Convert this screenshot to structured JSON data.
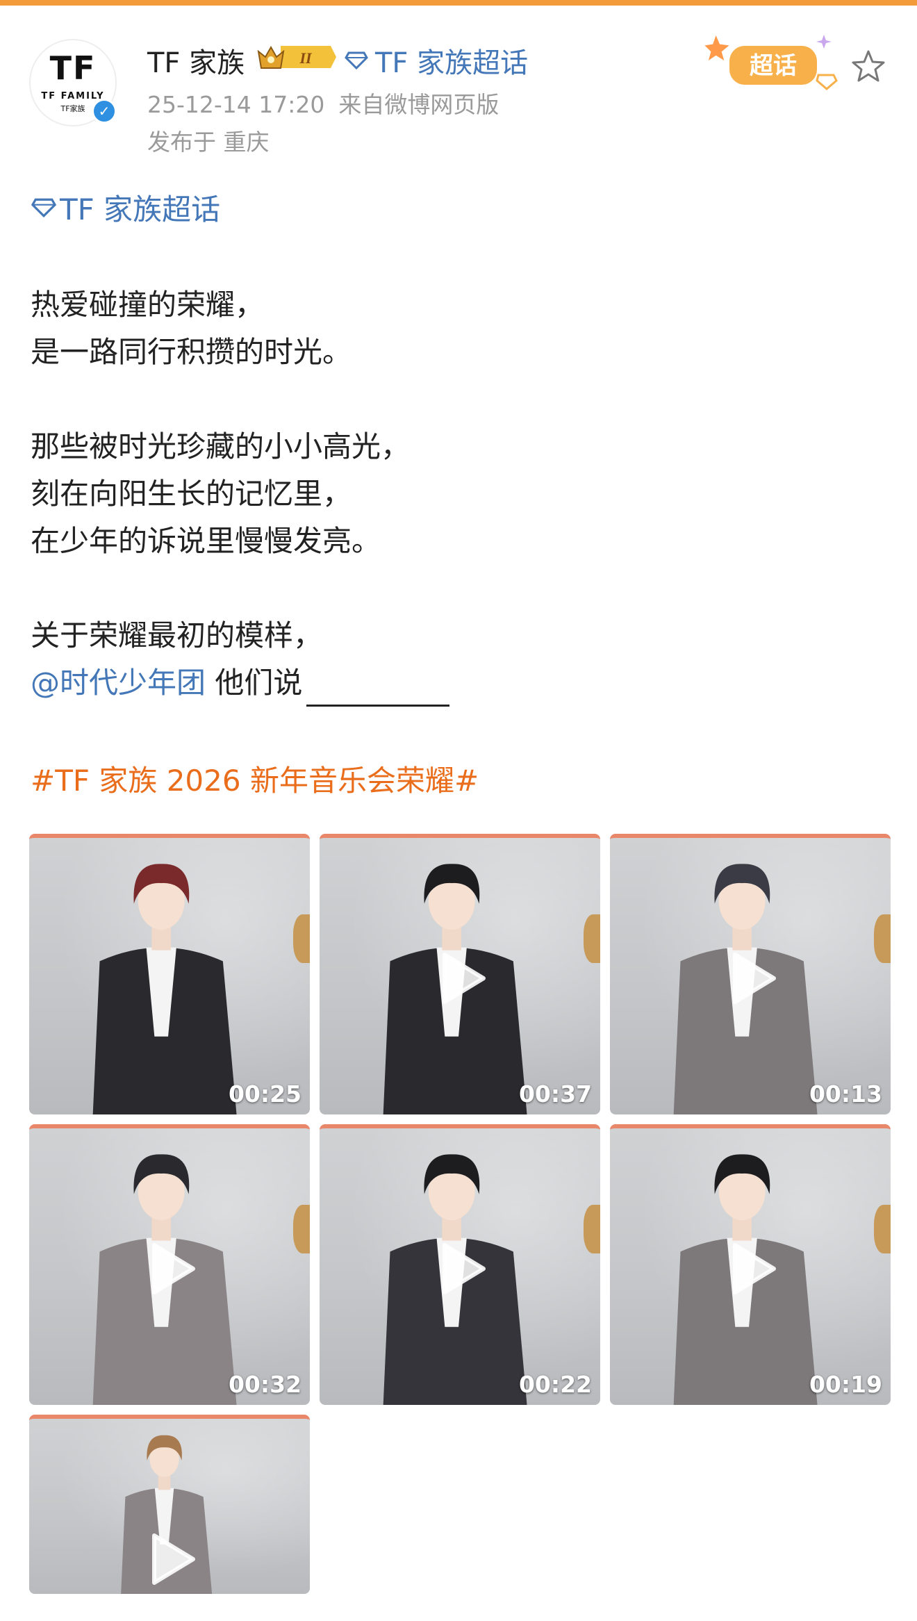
{
  "post": {
    "user_name": "TF 家族",
    "super_topic_link": "TF 家族超话",
    "timestamp": "25-12-14 17:20",
    "source": "来自微博网页版",
    "location": "发布于 重庆",
    "avatar_logo": "TF",
    "avatar_sub": "TF FAMILY",
    "avatar_sub2": "TF家族",
    "rank_badge_label": "II",
    "sticker_label": "超话"
  },
  "content": {
    "topic": "TF 家族超话",
    "paragraphs": [
      [
        "热爱碰撞的荣耀，",
        "是一路同行积攒的时光。"
      ],
      [
        "那些被时光珍藏的小小高光，",
        "刻在向阳生长的记忆里，",
        "在少年的诉说里慢慢发亮。"
      ]
    ],
    "last_line_1": "关于荣耀最初的模样，",
    "mention": "@时代少年团",
    "mention_suffix": "他们说",
    "hashtag": "#TF 家族 2026 新年音乐会荣耀#"
  },
  "videos": [
    {
      "duration": "00:25",
      "hair": "#7a2a2a",
      "suit": "#2a2a2e",
      "play": false
    },
    {
      "duration": "00:37",
      "hair": "#1d1d20",
      "suit": "#2a2a2e",
      "play": true
    },
    {
      "duration": "00:13",
      "hair": "#3a3b44",
      "suit": "#7d787a",
      "play": true
    },
    {
      "duration": "00:32",
      "hair": "#2a2a2e",
      "suit": "#8a8486",
      "play": true
    },
    {
      "duration": "00:22",
      "hair": "#1d1d20",
      "suit": "#34343a",
      "play": true
    },
    {
      "duration": "00:19",
      "hair": "#1d1d20",
      "suit": "#7d787a",
      "play": true
    },
    {
      "duration": "",
      "hair": "#a87a50",
      "suit": "#8a8486",
      "play": true
    }
  ],
  "colors": {
    "link_blue": "#4477b8",
    "hashtag_orange": "#ea6d1c",
    "meta_gray": "#9a9a9a",
    "verified_blue": "#2f8fe0"
  },
  "icons": [
    "diamond-icon",
    "star-icon",
    "verified-icon",
    "play-icon",
    "crown-icon"
  ]
}
